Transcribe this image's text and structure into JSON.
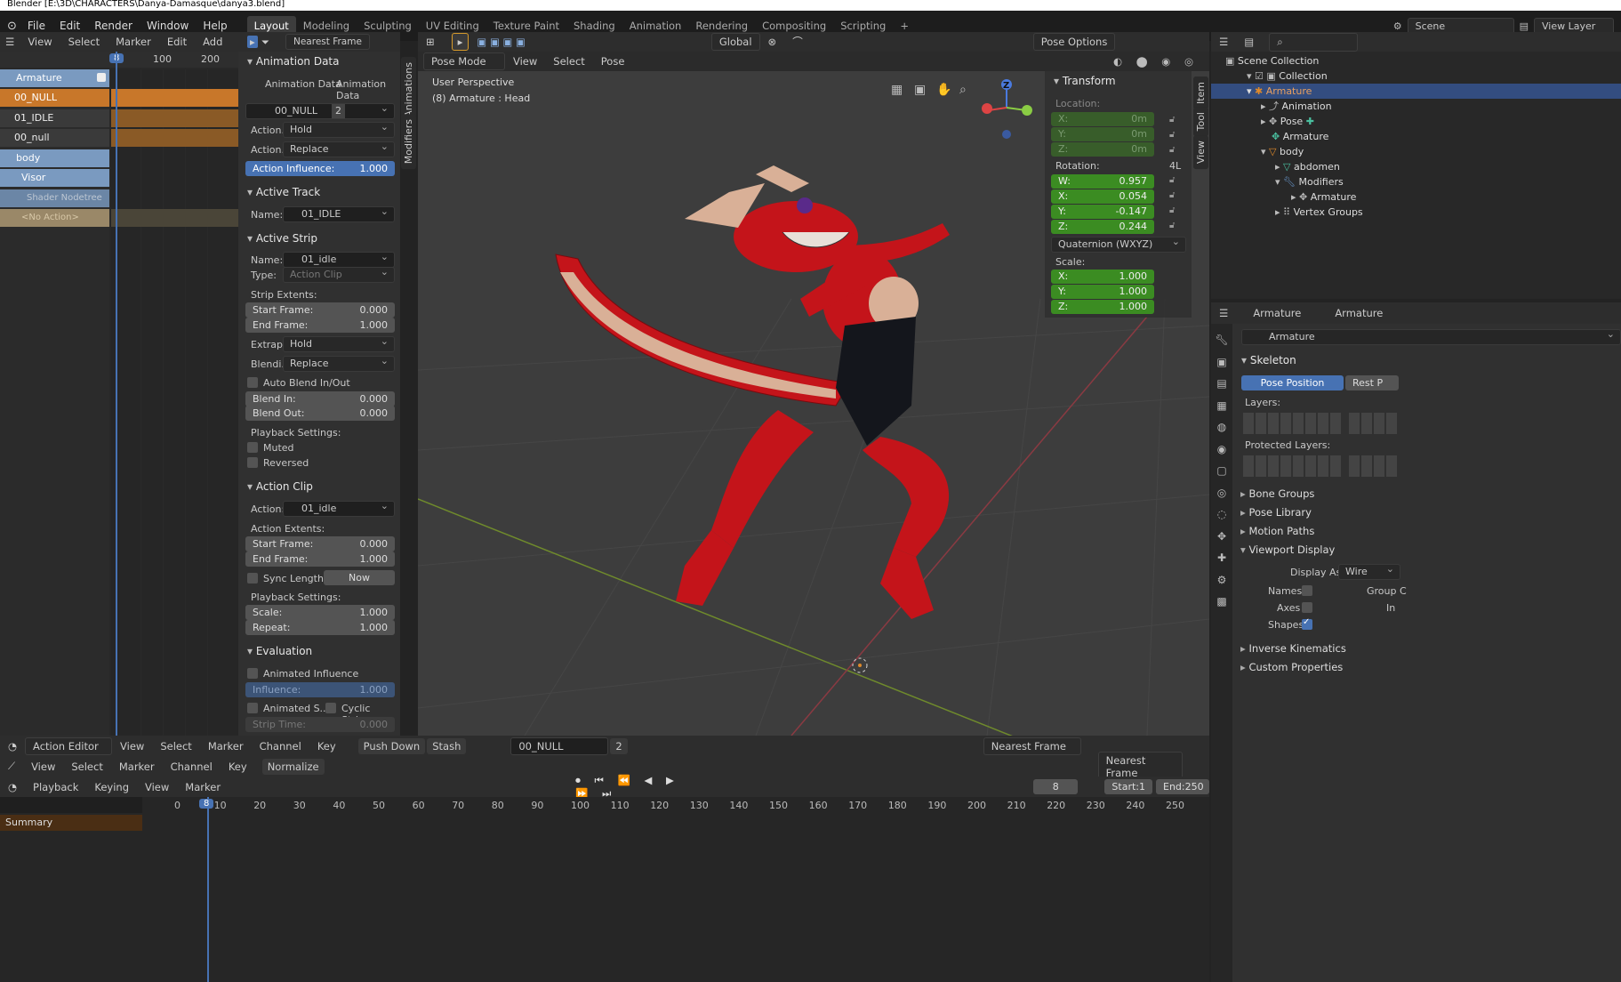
{
  "window": {
    "title": "Blender [E:\\3D\\CHARACTERS\\Danya-Damasque\\danya3.blend]"
  },
  "menu": [
    "File",
    "Edit",
    "Render",
    "Window",
    "Help"
  ],
  "workspaces": [
    "Layout",
    "Modeling",
    "Sculpting",
    "UV Editing",
    "Texture Paint",
    "Shading",
    "Animation",
    "Rendering",
    "Compositing",
    "Scripting"
  ],
  "workspace_add": "+",
  "scene": {
    "label": "Scene",
    "view_layer": "View Layer"
  },
  "nla": {
    "menu": [
      "View",
      "Select",
      "Marker",
      "Edit",
      "Add"
    ],
    "current_frame": "8",
    "ruler": [
      "100",
      "200"
    ],
    "tracks": [
      {
        "name": "Armature",
        "type": "object"
      },
      {
        "name": "00_NULL",
        "type": "action-active"
      },
      {
        "name": "01_IDLE",
        "type": "track"
      },
      {
        "name": "00_null",
        "type": "track"
      },
      {
        "name": "body",
        "type": "object"
      },
      {
        "name": "Visor",
        "type": "object"
      },
      {
        "name": "Shader Nodetree",
        "type": "sub"
      },
      {
        "name": "<No Action>",
        "type": "noaction"
      }
    ]
  },
  "strip_panel": {
    "snap": "Nearest Frame",
    "tabs": [
      "Animation Data",
      "Animation Data"
    ],
    "action": {
      "name": "00_NULL",
      "users": "2"
    },
    "action_hold": {
      "label": "Action..",
      "value": "Hold"
    },
    "action_replace": {
      "label": "Action..",
      "value": "Replace"
    },
    "influence": {
      "label": "Action Influence:",
      "value": "1.000"
    },
    "active_track": {
      "title": "Active Track",
      "name_label": "Name:",
      "name": "01_IDLE"
    },
    "active_strip": {
      "title": "Active Strip",
      "name_label": "Name:",
      "name": "01_idle",
      "type_label": "Type:",
      "type": "Action Clip",
      "extents": "Strip Extents:",
      "start": {
        "label": "Start Frame:",
        "value": "0.000"
      },
      "end": {
        "label": "End Frame:",
        "value": "1.000"
      },
      "extrap": {
        "label": "Extrap..",
        "value": "Hold"
      },
      "blend": {
        "label": "Blendi..",
        "value": "Replace"
      },
      "auto_blend": "Auto Blend In/Out",
      "blend_in": {
        "label": "Blend In:",
        "value": "0.000"
      },
      "blend_out": {
        "label": "Blend Out:",
        "value": "0.000"
      },
      "playback": "Playback Settings:",
      "muted": "Muted",
      "reversed": "Reversed"
    },
    "action_clip": {
      "title": "Action Clip",
      "action_label": "Action:",
      "action": "01_idle",
      "extents": "Action Extents:",
      "start": {
        "label": "Start Frame:",
        "value": "0.000"
      },
      "end": {
        "label": "End Frame:",
        "value": "1.000"
      },
      "sync": "Sync Length",
      "now": "Now",
      "playback": "Playback Settings:",
      "scale": {
        "label": "Scale:",
        "value": "1.000"
      },
      "repeat": {
        "label": "Repeat:",
        "value": "1.000"
      }
    },
    "evaluation": {
      "title": "Evaluation",
      "animated_influence": "Animated Influence",
      "influence": {
        "label": "Influence:",
        "value": "1.000"
      },
      "animated_s": "Animated S..",
      "cyclic": "Cyclic Strip..",
      "strip_time": {
        "label": "Strip Time:",
        "value": "0.000"
      }
    },
    "side_tabs": [
      "Animations",
      "Modifiers"
    ]
  },
  "viewport": {
    "header": {
      "orientation": "Global",
      "pose_options": "Pose Options",
      "mode": "Pose Mode",
      "menu": [
        "View",
        "Select",
        "Pose"
      ]
    },
    "overlay_title": "User Perspective",
    "overlay_sub": "(8) Armature : Head",
    "gizmo": {
      "x": "X",
      "y": "Y",
      "z": "Z"
    },
    "side_tabs": [
      "Item",
      "Tool",
      "View"
    ]
  },
  "transform": {
    "title": "Transform",
    "location_label": "Location:",
    "location": [
      {
        "axis": "X:",
        "value": "0m"
      },
      {
        "axis": "Y:",
        "value": "0m"
      },
      {
        "axis": "Z:",
        "value": "0m"
      }
    ],
    "rotation_label": "Rotation:",
    "rotation_mode_short": "4L",
    "rotation": [
      {
        "axis": "W:",
        "value": "0.957"
      },
      {
        "axis": "X:",
        "value": "0.054"
      },
      {
        "axis": "Y:",
        "value": "-0.147"
      },
      {
        "axis": "Z:",
        "value": "0.244"
      }
    ],
    "rotation_mode": "Quaternion (WXYZ)",
    "scale_label": "Scale:",
    "scale": [
      {
        "axis": "X:",
        "value": "1.000"
      },
      {
        "axis": "Y:",
        "value": "1.000"
      },
      {
        "axis": "Z:",
        "value": "1.000"
      }
    ]
  },
  "outliner": {
    "rows": [
      {
        "label": "Scene Collection",
        "depth": 0
      },
      {
        "label": "Collection",
        "depth": 1
      },
      {
        "label": "Armature",
        "depth": 2
      },
      {
        "label": "Animation",
        "depth": 3
      },
      {
        "label": "Pose",
        "depth": 3
      },
      {
        "label": "Armature",
        "depth": 3
      },
      {
        "label": "body",
        "depth": 3
      },
      {
        "label": "abdomen",
        "depth": 4
      },
      {
        "label": "Modifiers",
        "depth": 4
      },
      {
        "label": "Armature",
        "depth": 5
      },
      {
        "label": "Vertex Groups",
        "depth": 4
      }
    ]
  },
  "properties": {
    "breadcrumb": [
      "Armature",
      "Armature"
    ],
    "name": "Armature",
    "skeleton": "Skeleton",
    "pose_position": "Pose Position",
    "rest_position": "Rest P",
    "layers": "Layers:",
    "protected_layers": "Protected Layers:",
    "sections": [
      "Bone Groups",
      "Pose Library",
      "Motion Paths"
    ],
    "viewport_display": "Viewport Display",
    "display_as": {
      "label": "Display As",
      "value": "Wire"
    },
    "names": "Names",
    "axes": "Axes",
    "shapes": "Shapes",
    "group_c": "Group C",
    "in_front": "In",
    "sections2": [
      "Inverse Kinematics",
      "Custom Properties"
    ]
  },
  "action_editor": {
    "mode": "Action Editor",
    "menu": [
      "View",
      "Select",
      "Marker",
      "Channel",
      "Key"
    ],
    "push_down": "Push Down",
    "stash": "Stash",
    "action": "00_NULL",
    "users": "2",
    "snap": "Nearest Frame"
  },
  "graph_row": {
    "menu": [
      "View",
      "Select",
      "Marker",
      "Channel",
      "Key"
    ],
    "normalize": "Normalize",
    "snap": "Nearest Frame"
  },
  "timeline": {
    "menu": [
      "Playback",
      "Keying",
      "View",
      "Marker"
    ],
    "current_frame": "8",
    "start": {
      "label": "Start:",
      "value": "1"
    },
    "end": {
      "label": "End:",
      "value": "250"
    },
    "ruler": [
      "0",
      "10",
      "20",
      "30",
      "40",
      "50",
      "60",
      "70",
      "80",
      "90",
      "100",
      "110",
      "120",
      "130",
      "140",
      "150",
      "160",
      "170",
      "180",
      "190",
      "200",
      "210",
      "220",
      "230",
      "240",
      "250"
    ],
    "summary": "Summary"
  },
  "colors": {
    "accent": "#4772b3",
    "orange": "#c8772a",
    "track_blue": "#7a9ac0",
    "green": "#3b8c22",
    "character_red": "#c4141a"
  }
}
